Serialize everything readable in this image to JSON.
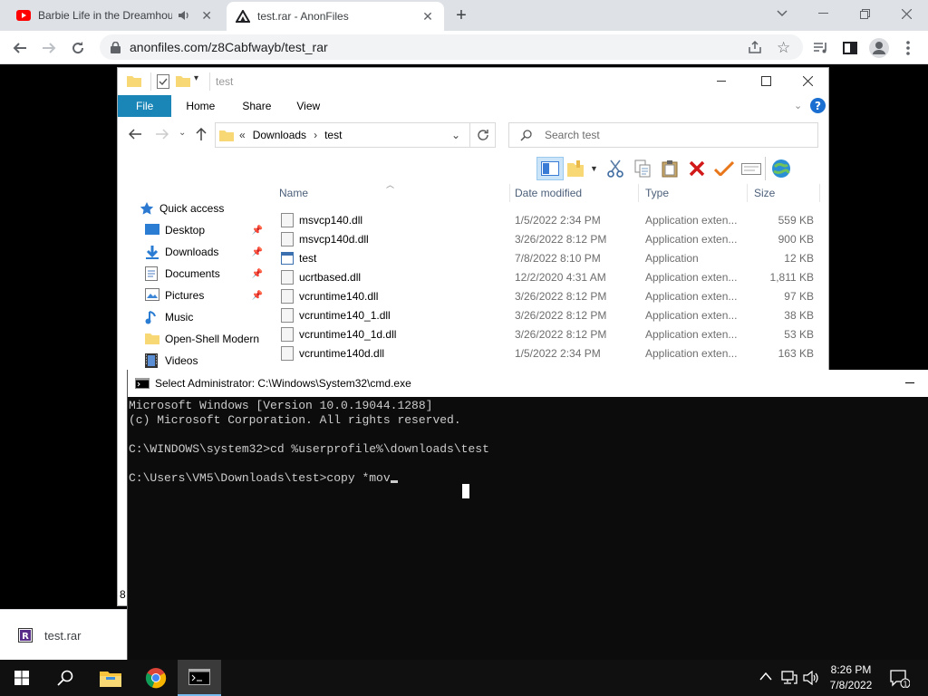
{
  "browser": {
    "tabs": [
      {
        "title": "Barbie Life in the Dreamhouse",
        "icon": "youtube-icon"
      },
      {
        "title": "test.rar - AnonFiles",
        "icon": "anonfiles-icon"
      }
    ],
    "url": "anonfiles.com/z8Cabfwayb/test_rar"
  },
  "explorer": {
    "title": "test",
    "ribbon_tabs": [
      "File",
      "Home",
      "Share",
      "View"
    ],
    "breadcrumb": {
      "prefix": "«",
      "parts": [
        "Downloads",
        "test"
      ]
    },
    "search_placeholder": "Search test",
    "columns": {
      "name": "Name",
      "date": "Date modified",
      "type": "Type",
      "size": "Size"
    },
    "nav": [
      {
        "label": "Quick access",
        "icon": "star-icon"
      },
      {
        "label": "Desktop",
        "icon": "desktop-icon"
      },
      {
        "label": "Downloads",
        "icon": "download-icon"
      },
      {
        "label": "Documents",
        "icon": "documents-icon"
      },
      {
        "label": "Pictures",
        "icon": "pictures-icon"
      },
      {
        "label": "Music",
        "icon": "music-icon"
      },
      {
        "label": "Open-Shell Modern",
        "icon": "folder-icon"
      },
      {
        "label": "Videos",
        "icon": "videos-icon"
      }
    ],
    "files": [
      {
        "name": "msvcp140.dll",
        "date": "1/5/2022 2:34 PM",
        "type": "Application exten...",
        "size": "559 KB"
      },
      {
        "name": "msvcp140d.dll",
        "date": "3/26/2022 8:12 PM",
        "type": "Application exten...",
        "size": "900 KB"
      },
      {
        "name": "test",
        "date": "7/8/2022 8:10 PM",
        "type": "Application",
        "size": "12 KB"
      },
      {
        "name": "ucrtbased.dll",
        "date": "12/2/2020 4:31 AM",
        "type": "Application exten...",
        "size": "1,811 KB"
      },
      {
        "name": "vcruntime140.dll",
        "date": "3/26/2022 8:12 PM",
        "type": "Application exten...",
        "size": "97 KB"
      },
      {
        "name": "vcruntime140_1.dll",
        "date": "3/26/2022 8:12 PM",
        "type": "Application exten...",
        "size": "38 KB"
      },
      {
        "name": "vcruntime140_1d.dll",
        "date": "3/26/2022 8:12 PM",
        "type": "Application exten...",
        "size": "53 KB"
      },
      {
        "name": "vcruntime140d.dll",
        "date": "1/5/2022 2:34 PM",
        "type": "Application exten...",
        "size": "163 KB"
      }
    ],
    "item_count_fragment": "8"
  },
  "cmd": {
    "title": "Select Administrator: C:\\Windows\\System32\\cmd.exe",
    "lines": [
      "Microsoft Windows [Version 10.0.19044.1288]",
      "(c) Microsoft Corporation. All rights reserved.",
      "",
      "C:\\WINDOWS\\system32>cd %userprofile%\\downloads\\test",
      "",
      "C:\\Users\\VM5\\Downloads\\test>copy *mov"
    ]
  },
  "download": {
    "filename": "test.rar"
  },
  "taskbar": {
    "time": "8:26 PM",
    "date": "7/8/2022"
  }
}
